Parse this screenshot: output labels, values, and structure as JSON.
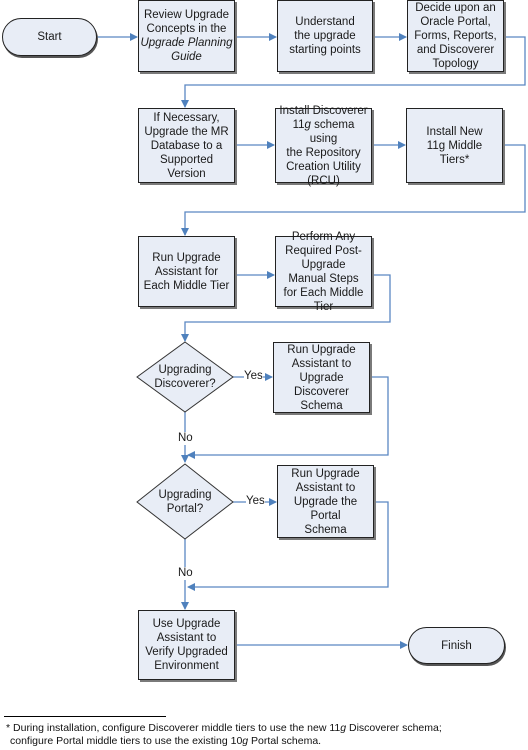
{
  "diagram": {
    "type": "flowchart",
    "colors": {
      "node_fill": "#e8edf6",
      "node_border": "#222222",
      "connector": "#4f81bd"
    },
    "nodes": {
      "start": {
        "label": "Start",
        "shape": "terminator"
      },
      "review": {
        "line1": "Review Upgrade",
        "line2": "Concepts in the",
        "line3_italic": "Upgrade Planning",
        "line4_italic": "Guide",
        "shape": "process"
      },
      "understand": {
        "label": "Understand the upgrade starting points",
        "shape": "process"
      },
      "decide": {
        "label": "Decide upon an Oracle Portal, Forms, Reports, and Discoverer Topology",
        "shape": "process"
      },
      "mr_database": {
        "label": "If Necessary, Upgrade the MR Database to a Supported Version",
        "shape": "process"
      },
      "install_schema": {
        "line1": "Install Discoverer",
        "line2_num": "11",
        "line2_italic": "g",
        "line2_rest": " schema using",
        "line3": "the Repository Creation Utility (RCU)",
        "shape": "process"
      },
      "install_middle_tiers": {
        "label": "Install New 11g Middle Tiers*",
        "shape": "process"
      },
      "run_ua_middle_tier": {
        "label": "Run Upgrade Assistant for Each Middle Tier",
        "shape": "process"
      },
      "post_upgrade_steps": {
        "label": "Perform Any Required Post-Upgrade Manual Steps for Each Middle Tier",
        "shape": "process"
      },
      "decision_discoverer": {
        "label": "Upgrading Discoverer?",
        "shape": "decision"
      },
      "upgrade_discoverer_schema": {
        "label": "Run Upgrade Assistant to Upgrade Discoverer Schema",
        "shape": "process"
      },
      "decision_portal": {
        "label": "Upgrading Portal?",
        "shape": "decision"
      },
      "upgrade_portal_schema": {
        "label": "Run Upgrade Assistant to Upgrade the Portal Schema",
        "shape": "process"
      },
      "verify": {
        "label": "Use Upgrade Assistant to Verify Upgraded Environment",
        "shape": "process"
      },
      "finish": {
        "label": "Finish",
        "shape": "terminator"
      }
    },
    "edge_labels": {
      "discoverer_yes": "Yes",
      "discoverer_no": "No",
      "portal_yes": "Yes",
      "portal_no": "No"
    },
    "edges": [
      [
        "start",
        "review"
      ],
      [
        "review",
        "understand"
      ],
      [
        "understand",
        "decide"
      ],
      [
        "decide",
        "mr_database"
      ],
      [
        "mr_database",
        "install_schema"
      ],
      [
        "install_schema",
        "install_middle_tiers"
      ],
      [
        "install_middle_tiers",
        "run_ua_middle_tier"
      ],
      [
        "run_ua_middle_tier",
        "post_upgrade_steps"
      ],
      [
        "post_upgrade_steps",
        "decision_discoverer"
      ],
      [
        "decision_discoverer",
        "upgrade_discoverer_schema",
        "Yes"
      ],
      [
        "decision_discoverer",
        "decision_portal",
        "No"
      ],
      [
        "upgrade_discoverer_schema",
        "decision_portal"
      ],
      [
        "decision_portal",
        "upgrade_portal_schema",
        "Yes"
      ],
      [
        "decision_portal",
        "verify",
        "No"
      ],
      [
        "upgrade_portal_schema",
        "verify"
      ],
      [
        "verify",
        "finish"
      ]
    ]
  },
  "footnote": {
    "marker": "*",
    "line1_a": "During installation, configure  Discoverer middle tiers to use the new 11",
    "line1_g": "g",
    "line1_b": " Discoverer schema;",
    "line2_a": "configure Portal middle tiers to use the existing 10",
    "line2_g": "g",
    "line2_b": " Portal schema."
  }
}
